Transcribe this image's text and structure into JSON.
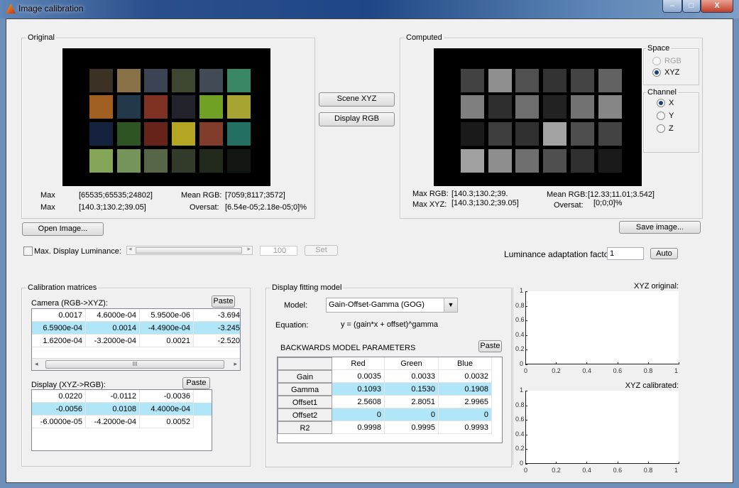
{
  "window": {
    "title": "Image calibration",
    "minimize": "–",
    "maximize": "□",
    "close": "X"
  },
  "original": {
    "legend": "Original",
    "max_label_1": "Max",
    "max_value_1": "[65535;65535;24802]",
    "max_label_2": "Max",
    "max_value_2": "[140.3;130.2;39.05]",
    "mean_label": "Mean RGB:",
    "mean_value": "[7059;8117;3572]",
    "oversat_label": "Oversat:",
    "oversat_value": "[6.54e-05;2.18e-05;0]%",
    "patch_colors": [
      "#3b3124",
      "#8a7248",
      "#3c4454",
      "#3d4631",
      "#414b55",
      "#3a8766",
      "#a25f22",
      "#22394c",
      "#7f3224",
      "#22222a",
      "#71a124",
      "#a8a432",
      "#14223e",
      "#2f5424",
      "#66231a",
      "#b4a622",
      "#823c2c",
      "#237062",
      "#84a656",
      "#74945a",
      "#566646",
      "#323a2a",
      "#222a1c",
      "#121612"
    ]
  },
  "buttons": {
    "scene_xyz": "Scene XYZ",
    "display_rgb": "Display RGB",
    "open_image": "Open Image...",
    "save_image": "Save image...",
    "set": "Set",
    "auto": "Auto"
  },
  "luminance": {
    "checkbox_label": "Max. Display Luminance:",
    "value": "100",
    "slider_fraction": 0.0,
    "adapt_label": "Luminance adaptation factor:",
    "adapt_value": "1"
  },
  "computed": {
    "legend": "Computed",
    "max_rgb_label": "Max RGB:",
    "max_rgb_value": "[140.3;130.2;39.",
    "max_xyz_label": "Max XYZ:",
    "max_xyz_value": "[140.3;130.2;39.05]",
    "mean_label": "Mean RGB:",
    "mean_value": "[12.33;11.01;3.542]",
    "oversat_label": "Oversat:",
    "oversat_value": "[0;0;0]%",
    "patch_colors": [
      "#424242",
      "#8f8f8f",
      "#505050",
      "#333333",
      "#444444",
      "#626262",
      "#7f7f7f",
      "#2e2e2e",
      "#6e6e6e",
      "#222222",
      "#727272",
      "#868686",
      "#1a1a1a",
      "#3e3e3e",
      "#303030",
      "#a3a3a3",
      "#4e4e4e",
      "#434343",
      "#a0a0a0",
      "#8e8e8e",
      "#6f6f6f",
      "#4f4f4f",
      "#303030",
      "#1a1a1a"
    ],
    "space": {
      "legend": "Space",
      "options": [
        "RGB",
        "XYZ"
      ],
      "selected": "XYZ"
    },
    "channel": {
      "legend": "Channel",
      "options": [
        "X",
        "Y",
        "Z"
      ],
      "selected": "X"
    }
  },
  "calibration": {
    "legend": "Calibration matrices",
    "camera_label": "Camera (RGB->XYZ):",
    "paste": "Paste",
    "camera_rows": [
      [
        "0.0017",
        "4.6000e-04",
        "5.9500e-06",
        "-3.694"
      ],
      [
        "6.5900e-04",
        "0.0014",
        "-4.4900e-04",
        "-3.245"
      ],
      [
        "1.6200e-04",
        "-3.2000e-04",
        "0.0021",
        "-2.520"
      ]
    ],
    "scroll_grip": "III",
    "display_label": "Display (XYZ->RGB):",
    "display_rows": [
      [
        "0.0220",
        "-0.0112",
        "-0.0036"
      ],
      [
        "-0.0056",
        "0.0108",
        "4.4000e-04"
      ],
      [
        "-6.0000e-05",
        "-4.2000e-04",
        "0.0052"
      ]
    ]
  },
  "fitting": {
    "legend": "Display fitting model",
    "model_label": "Model:",
    "model_value": "Gain-Offset-Gamma (GOG)",
    "equation_label": "Equation:",
    "equation": "y = (gain*x + offset)^gamma",
    "params_title": "BACKWARDS MODEL PARAMETERS",
    "paste": "Paste",
    "columns": [
      "Red",
      "Green",
      "Blue"
    ],
    "rows": [
      {
        "name": "Gain",
        "values": [
          "0.0035",
          "0.0033",
          "0.0032"
        ]
      },
      {
        "name": "Gamma",
        "values": [
          "0.1093",
          "0.1530",
          "0.1908"
        ]
      },
      {
        "name": "Offset1",
        "values": [
          "2.5608",
          "2.8051",
          "2.9965"
        ]
      },
      {
        "name": "Offset2",
        "values": [
          "0",
          "0",
          "0"
        ]
      },
      {
        "name": "R2",
        "values": [
          "0.9998",
          "0.9995",
          "0.9993"
        ]
      }
    ]
  },
  "plots": [
    {
      "title": "XYZ original:",
      "ticks": [
        "0",
        "0.2",
        "0.4",
        "0.6",
        "0.8",
        "1"
      ]
    },
    {
      "title": "XYZ calibrated:",
      "ticks": [
        "0",
        "0.2",
        "0.4",
        "0.6",
        "0.8",
        "1"
      ]
    }
  ]
}
